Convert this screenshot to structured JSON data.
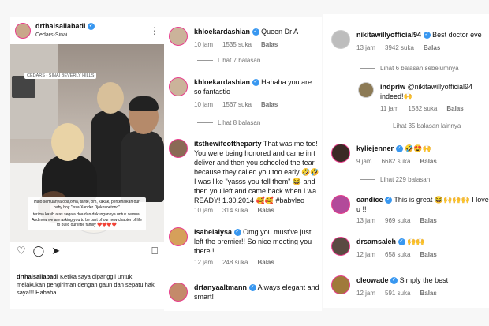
{
  "post": {
    "username": "drthaisaliabadi",
    "location": "Cedars-Sinai",
    "photo_tag": "CEDARS - SINAI BEVERLY HILLS",
    "overlay_p1": "Halo semuanya opa,oma, tante, om, kakak, perkenalkan our baby boy \"Issa Xander Djokosoetono\"",
    "overlay_p2": "terima kasih atas segala doa dan dukungannya untuk semua. And now we are asking you to be part of our new chapter of life to build our little family ❤️❤️❤️❤️",
    "caption_user": "drthaisaliabadi",
    "caption_text": "Ketika saya dipanggil untuk melakukan pengiriman dengan gaun dan sepatu hak saya!!! Hahaha..."
  },
  "col2": [
    {
      "user": "khloekardashian",
      "text": "Queen Dr A",
      "time": "10 jam",
      "likes": "1535 suka",
      "reply": "Balas"
    },
    {
      "more": "Lihat 7 balasan"
    },
    {
      "user": "khloekardashian",
      "text": "Hahaha you are so fantastic",
      "time": "10 jam",
      "likes": "1567 suka",
      "reply": "Balas"
    },
    {
      "more": "Lihat 8 balasan"
    },
    {
      "user": "itsthewifeoftheparty",
      "text": "That was me too! You were being honored and came in t deliver and then you schooled the tear because they called you too early 🤣🤣 I was like \"yasss you tell them\" 😂 and then you left and came back when i wa READY! 1.30.2014 🥰🥰 #babyleo",
      "time": "10 jam",
      "likes": "314 suka",
      "reply": "Balas"
    },
    {
      "user": "isabelalysa",
      "text": "Omg you must've just left the premier!! So nice meeting you there !",
      "time": "12 jam",
      "likes": "248 suka",
      "reply": "Balas"
    },
    {
      "user": "drtanyaaltmann",
      "text": "Always elegant and smart!"
    }
  ],
  "col3": [
    {
      "user": "nikitawillyofficial94",
      "text": "Best doctor eve",
      "time": "13 jam",
      "likes": "3942 suka",
      "reply": "Balas"
    },
    {
      "more": "Lihat 6 balasan sebelumnya"
    },
    {
      "user": "indpriw",
      "text": "@nikitawillyofficial94 indeed!🙌",
      "time": "11 jam",
      "likes": "1582 suka",
      "reply": "Balas"
    },
    {
      "more": "Lihat 35 balasan lainnya"
    },
    {
      "user": "kyliejenner",
      "text": "🤣😍🙌",
      "time": "9 jam",
      "likes": "6682 suka",
      "reply": "Balas"
    },
    {
      "more": "Lihat 229 balasan"
    },
    {
      "user": "candice",
      "text": "This is great 😂🙌🙌🙌 I love u !!",
      "time": "13 jam",
      "likes": "969 suka",
      "reply": "Balas"
    },
    {
      "user": "drsamsaleh",
      "text": "🙌🙌",
      "time": "12 jam",
      "likes": "658 suka",
      "reply": "Balas"
    },
    {
      "user": "cleowade",
      "text": "Simply the best",
      "time": "12 jam",
      "likes": "591 suka",
      "reply": "Balas"
    }
  ],
  "icons": {
    "verified": "✓",
    "heart": "♡",
    "kebab": "⋮",
    "like": "♡",
    "comment": "◯",
    "share": "➤",
    "save": "⎕"
  },
  "colors": {
    "accent": "#3897f0",
    "ring": "#e83e8c",
    "meta": "#737373"
  }
}
